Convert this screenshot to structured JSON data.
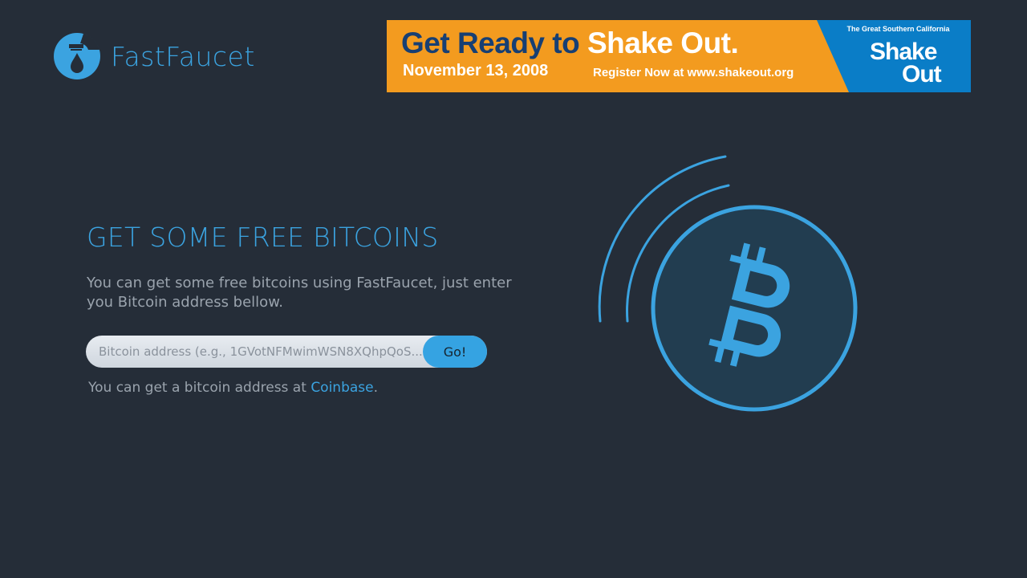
{
  "header": {
    "logo_text": "FastFaucet"
  },
  "banner": {
    "headline_dark": "Get Ready to",
    "headline_light": "Shake Out.",
    "date": "November 13, 2008",
    "register": "Register Now at www.shakeout.org",
    "tagline": "The Great Southern California",
    "brand_shake": "Shake",
    "brand_out": "Out",
    "colors": {
      "orange": "#f39b1f",
      "blue": "#0a7dc7",
      "navy": "#173f73"
    }
  },
  "hero": {
    "title": "GET SOME FREE BITCOINS",
    "description": "You can get some free bitcoins using FastFaucet, just enter you Bitcoin address bellow."
  },
  "form": {
    "address_placeholder": "Bitcoin address (e.g., 1GVotNFMwimWSN8XQhpQoS...",
    "submit_label": "Go!"
  },
  "hint": {
    "prefix": "You can get a bitcoin address at",
    "link_label": "Coinbase",
    "suffix": "."
  },
  "graphic": {
    "icon": "bitcoin-icon",
    "accent": "#3ba3e0",
    "fill": "#223d50"
  }
}
